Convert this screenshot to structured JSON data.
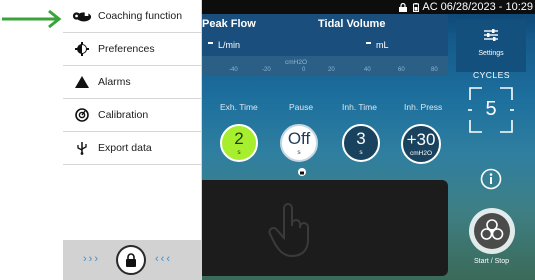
{
  "menu": {
    "items": [
      {
        "label": "Coaching function",
        "icon": "coaching-icon"
      },
      {
        "label": "Preferences",
        "icon": "preferences-icon"
      },
      {
        "label": "Alarms",
        "icon": "alarm-triangle-icon"
      },
      {
        "label": "Calibration",
        "icon": "calibration-icon"
      },
      {
        "label": "Export data",
        "icon": "usb-icon"
      }
    ],
    "lock_icon": "lock-icon"
  },
  "status_bar": {
    "power": "AC",
    "datetime": "06/28/2023 - 10:29"
  },
  "parameters": {
    "peak_flow_label": "Peak Flow",
    "peak_flow_unit": "L/min",
    "tidal_volume_label": "Tidal Volume",
    "tidal_volume_unit": "mL"
  },
  "pressure_scale": {
    "unit": "cmH2O",
    "ticks": [
      "-40",
      "-20",
      "0",
      "20",
      "40",
      "60",
      "80"
    ]
  },
  "controls": {
    "exh_time": {
      "label": "Exh. Time",
      "value": "2",
      "unit": "s"
    },
    "pause": {
      "label": "Pause",
      "value": "Off",
      "unit": "s"
    },
    "inh_time": {
      "label": "Inh. Time",
      "value": "3",
      "unit": "s"
    },
    "inh_press": {
      "label": "Inh. Press",
      "value": "+30",
      "unit": "cmH2O"
    }
  },
  "sidebar": {
    "settings_label": "Settings",
    "cycles_label": "CYCLES",
    "cycles_value": "5",
    "start_stop_label": "Start / Stop"
  },
  "colors": {
    "arrow": "#3aa33a",
    "exh_knob": "#a6ee2e",
    "chevrons": "#3a8fd8",
    "status_bar": "#0d0d0d"
  }
}
